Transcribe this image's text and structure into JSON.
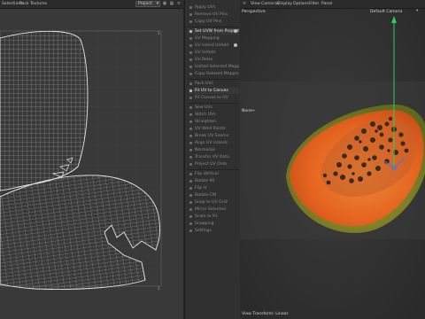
{
  "menu_bar": [
    "Selections",
    "Pack",
    "Textures"
  ],
  "uv_editor": {
    "mode_select": "Project"
  },
  "tools": {
    "items": [
      {
        "label": "Apply UVs",
        "active": false
      },
      {
        "label": "Remove UV Pins",
        "active": false
      },
      {
        "label": "Copy UV Pins",
        "active": false
      },
      {
        "label": "Set UVW from Projection",
        "active": true,
        "gear": true
      },
      {
        "label": "UV Mapping",
        "active": false
      },
      {
        "label": "UV Island Unfold",
        "active": false,
        "gear": true
      },
      {
        "label": "UV Unfold",
        "active": false
      },
      {
        "label": "UV Relax",
        "active": false
      },
      {
        "label": "Unfold Selected Mapping",
        "active": false
      },
      {
        "label": "Copy Relaxed Mapping",
        "active": false
      },
      {
        "label": "Pack UVs",
        "active": false
      },
      {
        "label": "Fit UV to Canvas",
        "active": true
      },
      {
        "label": "Fit Canvas to UV",
        "active": false
      },
      {
        "label": "Sew UVs",
        "active": false
      },
      {
        "label": "Stitch UVs",
        "active": false
      },
      {
        "label": "Straighten",
        "active": false
      },
      {
        "label": "UV Weld Points",
        "active": false
      },
      {
        "label": "Break UV Seams",
        "active": false
      },
      {
        "label": "Align UV Islands",
        "active": false
      },
      {
        "label": "Normalize",
        "active": false
      },
      {
        "label": "Transfer UV Data",
        "active": false
      },
      {
        "label": "Project UV Onto",
        "active": false
      },
      {
        "label": "Flip Vertical",
        "active": false
      },
      {
        "label": "Rotate 90",
        "active": false
      },
      {
        "label": "Flip H",
        "active": false
      },
      {
        "label": "Rotate CW",
        "active": false
      },
      {
        "label": "Snap to UV Grid",
        "active": false
      },
      {
        "label": "Mirror Selected",
        "active": false
      },
      {
        "label": "Scale to Fit",
        "active": false
      },
      {
        "label": "Snapping",
        "active": false
      },
      {
        "label": "Settings",
        "active": false
      }
    ]
  },
  "viewport": {
    "menu": [
      "View",
      "Cameras",
      "Display",
      "Options",
      "Filter",
      "Panel"
    ],
    "projection_label": "Perspective",
    "camera_label": "Default Camera",
    "side_tag": "None",
    "status_text": "View Transform: Linear"
  },
  "colors": {
    "uv_wire": "#dcdcdc",
    "grid_line": "#4a4a4a",
    "papaya_orange": "#e86a25",
    "papaya_skin": "#7a8a24",
    "seed": "#3a2a1c",
    "axis_green": "#2ecc5c",
    "axis_blue": "#3a74ff"
  }
}
